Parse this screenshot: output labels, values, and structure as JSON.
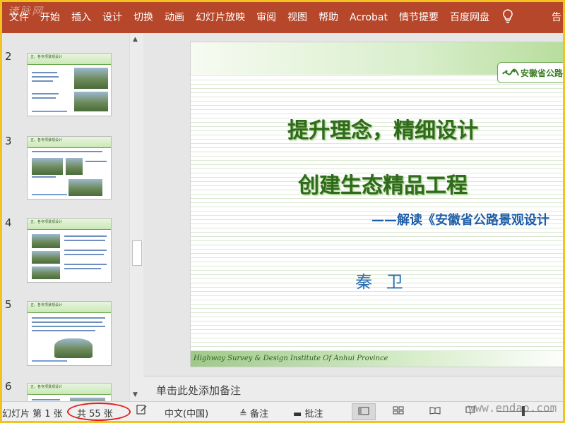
{
  "ribbon": {
    "tabs": [
      "文件",
      "开始",
      "插入",
      "设计",
      "切换",
      "动画",
      "幻灯片放映",
      "审阅",
      "视图",
      "帮助",
      "Acrobat",
      "情节提要",
      "百度网盘"
    ],
    "lightbulb_icon": "lightbulb-icon",
    "share_partial": "告"
  },
  "watermarks": {
    "top": "诸脉网",
    "bottom": "www.endao.com"
  },
  "thumbnails": [
    {
      "number": "2",
      "heading": "五、各专项景观设计",
      "sub": "5.1 公路景观绿化系统设计"
    },
    {
      "number": "3",
      "heading": "五、各专项景观设计",
      "sub": "5.2 互通立交景观设计"
    },
    {
      "number": "4",
      "heading": "五、各专项景观设计",
      "sub": "5.3 边坡景观设计"
    },
    {
      "number": "5",
      "heading": "五、各专项景观设计",
      "sub": "5.4 互通立交景观设计"
    },
    {
      "number": "6",
      "heading": "五、各专项景观设计",
      "sub": "5.4 服务区景观设计"
    }
  ],
  "slide": {
    "badge": "安徽省公路",
    "title_line1": "提升理念，精细设计",
    "title_line2": "创建生态精品工程",
    "subtitle": "——解读《安徽省公路景观设计",
    "author": "秦 卫",
    "footer": "Highway Survey & Design Institute Of Anhui Province"
  },
  "notes": {
    "placeholder": "单击此处添加备注"
  },
  "status": {
    "slide_label": "幻灯片 第 1 张",
    "total_label": "共 55 张",
    "language": "中文(中国)",
    "notes_button": "备注",
    "comments_button": "批注",
    "annotation_color": "#e0201b"
  }
}
